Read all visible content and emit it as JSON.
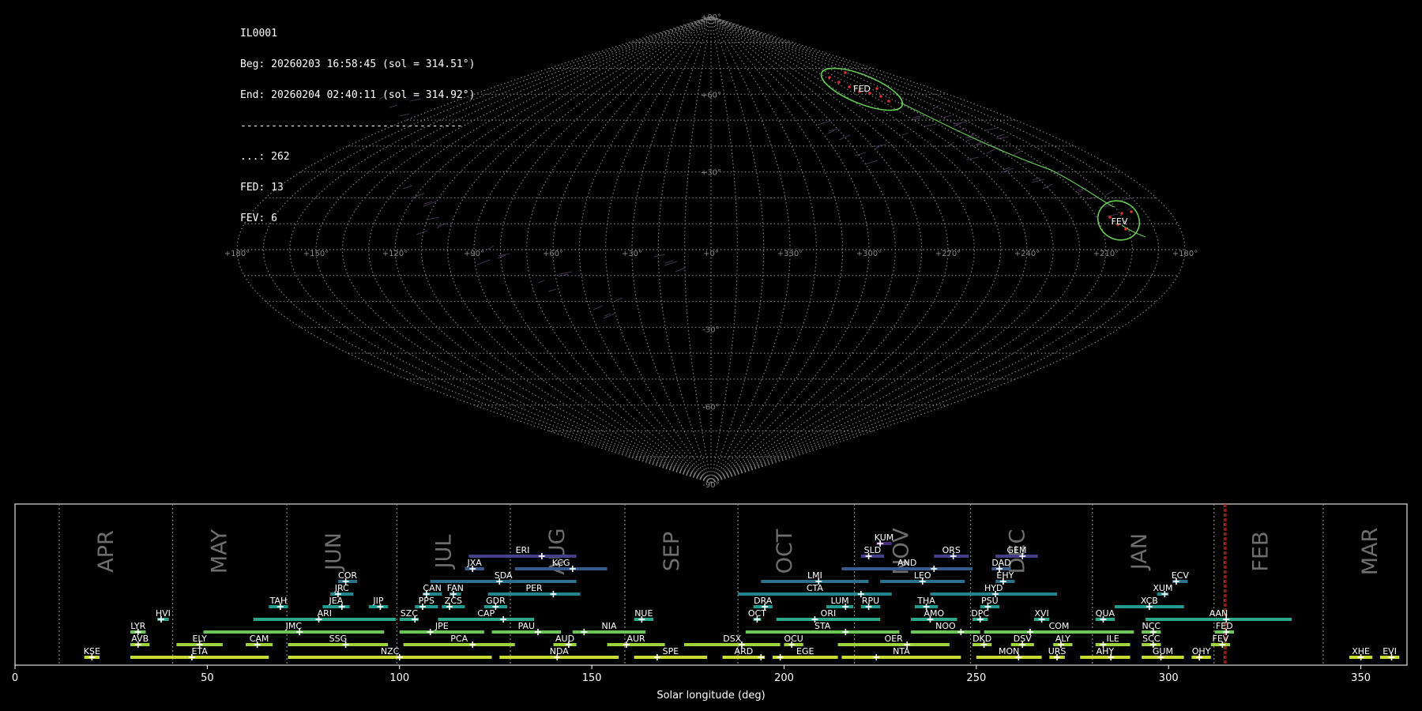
{
  "header": {
    "station": "IL0001",
    "beg": "Beg: 20260203 16:58:45 (sol = 314.51°)",
    "end": "End: 20260204 02:40:11 (sol = 314.92°)",
    "rule": "------------------------------------",
    "counts": [
      "...: 262",
      "FED: 13",
      "FEV: 6"
    ]
  },
  "skymap": {
    "projection": "sinusoidal",
    "lon_ticks": [
      "+180°",
      "+150°",
      "+120°",
      "+90°",
      "+60°",
      "+30°",
      "+0°",
      "+330°",
      "+300°",
      "+270°",
      "+240°",
      "+210°",
      "+180°"
    ],
    "lat_ticks": [
      "+90°",
      "+60°",
      "+30°",
      "-30°",
      "-60°",
      "-90°"
    ],
    "showers": [
      {
        "code": "FED",
        "ra": 291,
        "dec": 60,
        "color": "#66cc55"
      },
      {
        "code": "FEV",
        "ra": 210,
        "dec": 10,
        "color": "#66cc55"
      }
    ]
  },
  "chart_data": {
    "type": "gantt",
    "xlabel": "Solar longitude (deg)",
    "xlim": [
      0,
      362
    ],
    "xticks": [
      0,
      50,
      100,
      150,
      200,
      250,
      300,
      350
    ],
    "current_sol": [
      314.51,
      314.92
    ],
    "months": [
      {
        "name": "APR",
        "start": 11.5
      },
      {
        "name": "MAY",
        "start": 41
      },
      {
        "name": "JUN",
        "start": 70.7
      },
      {
        "name": "JUL",
        "start": 99.3
      },
      {
        "name": "AUG",
        "start": 128.8
      },
      {
        "name": "SEP",
        "start": 158.6
      },
      {
        "name": "OCT",
        "start": 188
      },
      {
        "name": "NOV",
        "start": 218.3
      },
      {
        "name": "DEC",
        "start": 248.5
      },
      {
        "name": "JAN",
        "start": 280.2
      },
      {
        "name": "FEB",
        "start": 311.8
      },
      {
        "name": "MAR",
        "start": 340.2
      }
    ],
    "showers": [
      {
        "code": "KSE",
        "row": 0,
        "start": 18,
        "end": 22,
        "peak": 20
      },
      {
        "code": "ETA",
        "row": 0,
        "start": 30,
        "end": 66,
        "peak": 46
      },
      {
        "code": "NZC",
        "row": 0,
        "start": 71,
        "end": 124,
        "peak": 100
      },
      {
        "code": "NDA",
        "row": 0,
        "start": 126,
        "end": 157,
        "peak": 141
      },
      {
        "code": "SPE",
        "row": 0,
        "start": 161,
        "end": 180,
        "peak": 167
      },
      {
        "code": "ARD",
        "row": 0,
        "start": 184,
        "end": 195,
        "peak": 194
      },
      {
        "code": "EGE",
        "row": 0,
        "start": 197,
        "end": 214,
        "peak": 199
      },
      {
        "code": "NTA",
        "row": 0,
        "start": 215,
        "end": 246,
        "peak": 224
      },
      {
        "code": "MON",
        "row": 0,
        "start": 250,
        "end": 267,
        "peak": 261
      },
      {
        "code": "URS",
        "row": 0,
        "start": 269,
        "end": 273,
        "peak": 271
      },
      {
        "code": "AHY",
        "row": 0,
        "start": 277,
        "end": 290,
        "peak": 285
      },
      {
        "code": "GUM",
        "row": 0,
        "start": 293,
        "end": 304,
        "peak": 298
      },
      {
        "code": "OHY",
        "row": 0,
        "start": 306,
        "end": 311,
        "peak": 308
      },
      {
        "code": "XHE",
        "row": 0,
        "start": 347,
        "end": 353,
        "peak": 350
      },
      {
        "code": "EVI",
        "row": 0,
        "start": 355,
        "end": 360,
        "peak": 358
      },
      {
        "code": "AVB",
        "row": 1,
        "start": 30,
        "end": 35,
        "peak": 32
      },
      {
        "code": "ELY",
        "row": 1,
        "start": 42,
        "end": 54,
        "peak": 48
      },
      {
        "code": "CAM",
        "row": 1,
        "start": 60,
        "end": 67,
        "peak": 63
      },
      {
        "code": "SSG",
        "row": 1,
        "start": 71,
        "end": 97,
        "peak": 86
      },
      {
        "code": "PCA",
        "row": 1,
        "start": 101,
        "end": 130,
        "peak": 119
      },
      {
        "code": "AUD",
        "row": 1,
        "start": 140,
        "end": 146,
        "peak": 144
      },
      {
        "code": "AUR",
        "row": 1,
        "start": 154,
        "end": 169,
        "peak": 159
      },
      {
        "code": "DSX",
        "row": 1,
        "start": 174,
        "end": 199,
        "peak": 189
      },
      {
        "code": "OCU",
        "row": 1,
        "start": 200,
        "end": 205,
        "peak": 202
      },
      {
        "code": "OER",
        "row": 1,
        "start": 214,
        "end": 243,
        "peak": 232
      },
      {
        "code": "DKD",
        "row": 1,
        "start": 249,
        "end": 254,
        "peak": 252
      },
      {
        "code": "DSV",
        "row": 1,
        "start": 259,
        "end": 265,
        "peak": 262
      },
      {
        "code": "ALY",
        "row": 1,
        "start": 270,
        "end": 275,
        "peak": 272
      },
      {
        "code": "ILE",
        "row": 1,
        "start": 281,
        "end": 290,
        "peak": 283
      },
      {
        "code": "SCC",
        "row": 1,
        "start": 293,
        "end": 298,
        "peak": 296
      },
      {
        "code": "FEV",
        "row": 1,
        "start": 311,
        "end": 316,
        "peak": 314
      },
      {
        "code": "LYR",
        "row": 2,
        "start": 30,
        "end": 34,
        "peak": 32
      },
      {
        "code": "JMC",
        "row": 2,
        "start": 49,
        "end": 96,
        "peak": 74
      },
      {
        "code": "JPE",
        "row": 2,
        "start": 100,
        "end": 122,
        "peak": 108
      },
      {
        "code": "PAU",
        "row": 2,
        "start": 124,
        "end": 142,
        "peak": 136
      },
      {
        "code": "NIA",
        "row": 2,
        "start": 145,
        "end": 164,
        "peak": 148
      },
      {
        "code": "STA",
        "row": 2,
        "start": 190,
        "end": 230,
        "peak": 216
      },
      {
        "code": "NOO",
        "row": 2,
        "start": 233,
        "end": 251,
        "peak": 246
      },
      {
        "code": "COM",
        "row": 2,
        "start": 252,
        "end": 291,
        "peak": 264
      },
      {
        "code": "NCC",
        "row": 2,
        "start": 293,
        "end": 298,
        "peak": 296
      },
      {
        "code": "FED",
        "row": 2,
        "start": 312,
        "end": 317,
        "peak": 315
      },
      {
        "code": "HVI",
        "row": 3,
        "start": 37,
        "end": 40,
        "peak": 38
      },
      {
        "code": "ARI",
        "row": 3,
        "start": 62,
        "end": 99,
        "peak": 79
      },
      {
        "code": "SZC",
        "row": 3,
        "start": 100,
        "end": 105,
        "peak": 104
      },
      {
        "code": "CAP",
        "row": 3,
        "start": 110,
        "end": 135,
        "peak": 127
      },
      {
        "code": "NUE",
        "row": 3,
        "start": 161,
        "end": 166,
        "peak": 163
      },
      {
        "code": "OCT",
        "row": 3,
        "start": 192,
        "end": 194,
        "peak": 193
      },
      {
        "code": "ORI",
        "row": 3,
        "start": 198,
        "end": 225,
        "peak": 208
      },
      {
        "code": "AMO",
        "row": 3,
        "start": 233,
        "end": 245,
        "peak": 238
      },
      {
        "code": "DPC",
        "row": 3,
        "start": 249,
        "end": 253,
        "peak": 251
      },
      {
        "code": "XVI",
        "row": 3,
        "start": 265,
        "end": 269,
        "peak": 267
      },
      {
        "code": "QUA",
        "row": 3,
        "start": 281,
        "end": 286,
        "peak": 283
      },
      {
        "code": "AAN",
        "row": 3,
        "start": 294,
        "end": 332,
        "peak": 315
      },
      {
        "code": "TAH",
        "row": 4,
        "start": 66,
        "end": 71,
        "peak": 69
      },
      {
        "code": "JEA",
        "row": 4,
        "start": 80,
        "end": 87,
        "peak": 85
      },
      {
        "code": "JIP",
        "row": 4,
        "start": 92,
        "end": 97,
        "peak": 95
      },
      {
        "code": "PPS",
        "row": 4,
        "start": 104,
        "end": 110,
        "peak": 106
      },
      {
        "code": "ZCS",
        "row": 4,
        "start": 111,
        "end": 117,
        "peak": 113
      },
      {
        "code": "GDR",
        "row": 4,
        "start": 122,
        "end": 128,
        "peak": 125
      },
      {
        "code": "DRA",
        "row": 4,
        "start": 192,
        "end": 197,
        "peak": 195
      },
      {
        "code": "LUM",
        "row": 4,
        "start": 211,
        "end": 218,
        "peak": 216
      },
      {
        "code": "RPU",
        "row": 4,
        "start": 220,
        "end": 225,
        "peak": 222
      },
      {
        "code": "THA",
        "row": 4,
        "start": 234,
        "end": 240,
        "peak": 237
      },
      {
        "code": "PSU",
        "row": 4,
        "start": 251,
        "end": 256,
        "peak": 253
      },
      {
        "code": "XCB",
        "row": 4,
        "start": 286,
        "end": 304,
        "peak": 295
      },
      {
        "code": "JRC",
        "row": 5,
        "start": 82,
        "end": 88,
        "peak": 84
      },
      {
        "code": "CAN",
        "row": 5,
        "start": 106,
        "end": 111,
        "peak": 107
      },
      {
        "code": "FAN",
        "row": 5,
        "start": 113,
        "end": 116,
        "peak": 114
      },
      {
        "code": "PER",
        "row": 5,
        "start": 123,
        "end": 147,
        "peak": 140
      },
      {
        "code": "CTA",
        "row": 5,
        "start": 188,
        "end": 228,
        "peak": 220
      },
      {
        "code": "HYD",
        "row": 5,
        "start": 238,
        "end": 271,
        "peak": 255
      },
      {
        "code": "XUM",
        "row": 5,
        "start": 297,
        "end": 300,
        "peak": 299
      },
      {
        "code": "COR",
        "row": 6,
        "start": 84,
        "end": 89,
        "peak": 86
      },
      {
        "code": "SDA",
        "row": 6,
        "start": 108,
        "end": 146,
        "peak": 126
      },
      {
        "code": "LMI",
        "row": 6,
        "start": 194,
        "end": 222,
        "peak": 209
      },
      {
        "code": "LEO",
        "row": 6,
        "start": 225,
        "end": 247,
        "peak": 236
      },
      {
        "code": "EHY",
        "row": 6,
        "start": 255,
        "end": 260,
        "peak": 257
      },
      {
        "code": "ECV",
        "row": 6,
        "start": 301,
        "end": 305,
        "peak": 302
      },
      {
        "code": "JXA",
        "row": 7,
        "start": 117,
        "end": 122,
        "peak": 119
      },
      {
        "code": "KCG",
        "row": 7,
        "start": 130,
        "end": 154,
        "peak": 145
      },
      {
        "code": "AND",
        "row": 7,
        "start": 215,
        "end": 249,
        "peak": 239
      },
      {
        "code": "DAD",
        "row": 7,
        "start": 254,
        "end": 259,
        "peak": 256
      },
      {
        "code": "ERI",
        "row": 8,
        "start": 118,
        "end": 146,
        "peak": 137
      },
      {
        "code": "SLD",
        "row": 8,
        "start": 220,
        "end": 226,
        "peak": 222
      },
      {
        "code": "ORS",
        "row": 8,
        "start": 239,
        "end": 248,
        "peak": 244
      },
      {
        "code": "GEM",
        "row": 8,
        "start": 255,
        "end": 266,
        "peak": 262
      },
      {
        "code": "KUM",
        "row": 9,
        "start": 224,
        "end": 228,
        "peak": 225
      }
    ],
    "row_colors": [
      "#c8dc32",
      "#a0d43c",
      "#6cc65a",
      "#2ea88a",
      "#229a90",
      "#24848c",
      "#2c708e",
      "#3a5a8c",
      "#46408a",
      "#4a2c7a"
    ]
  }
}
